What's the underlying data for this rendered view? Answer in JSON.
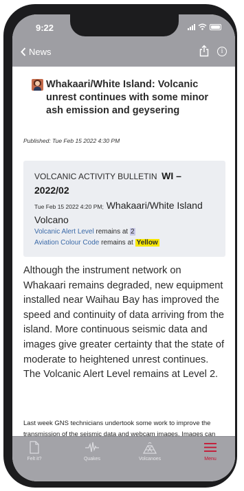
{
  "status_bar": {
    "time": "9:22"
  },
  "nav": {
    "back_label": "News",
    "info_glyph": "i"
  },
  "article": {
    "title": "Whakaari/White Island: Volcanic unrest continues with some minor ash emission and geysering",
    "published": "Published: Tue Feb 15 2022 4:30 PM"
  },
  "bulletin": {
    "heading": "VOLCANIC ACTIVITY BULLETIN",
    "code": "WI – 2022/02",
    "date": "Tue Feb 15 2022 4:20 PM;",
    "location": "Whakaari/White Island Volcano",
    "alert_label": "Volcanic Alert Level",
    "alert_text": " remains at ",
    "alert_value": "2",
    "aviation_label": "Aviation Colour Code",
    "aviation_text": " remains at ",
    "aviation_value": "Yellow"
  },
  "body": {
    "paragraph_1": "Although the instrument network on Whakaari remains degraded, new equipment installed near Waihau Bay has improved the speed and continuity of data arriving from the island. More continuous seismic data and images give greater certainty that the state of moderate to heightened unrest continues. The Volcanic Alert Level remains at Level 2.",
    "paragraph_2": "Last week GNS technicians undertook some work to improve the transmission of the seismic data and webcam images. Images can now be received more"
  },
  "tabs": [
    {
      "label": "Felt it?",
      "icon": "document-icon"
    },
    {
      "label": "Quakes",
      "icon": "seismograph-icon"
    },
    {
      "label": "Volcanoes",
      "icon": "volcano-icon"
    },
    {
      "label": "Menu",
      "icon": "hamburger-icon"
    }
  ],
  "colors": {
    "header_gray": "#9e9ea3",
    "tabbar_gray": "#a3a3a8",
    "link_blue": "#3b6aa8",
    "highlight_yellow": "#f6e600",
    "active_red": "#c8102e"
  }
}
